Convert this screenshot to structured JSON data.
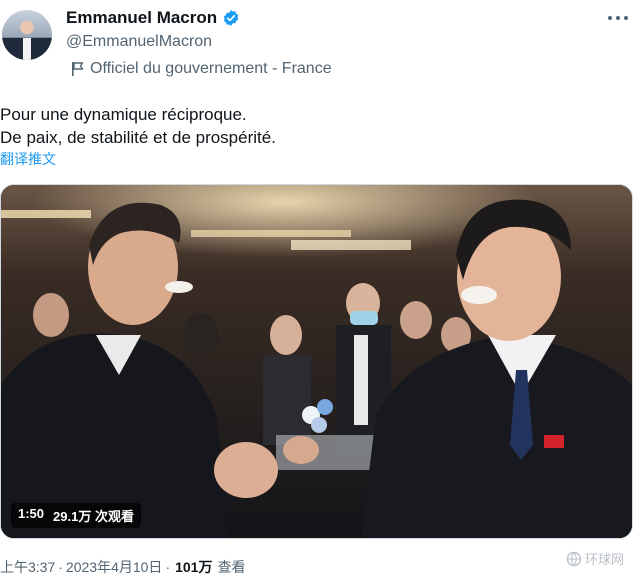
{
  "author": {
    "name": "Emmanuel Macron",
    "handle": "@EmmanuelMacron",
    "affiliation": "Officiel du gouvernement - France",
    "verified_icon": "verified-badge-icon",
    "affiliation_icon": "flag-icon"
  },
  "tweet": {
    "line1": "Pour une dynamique réciproque.",
    "line2": "De paix, de stabilité et de prospérité.",
    "translate_label": "翻译推文"
  },
  "media": {
    "duration": "1:50",
    "views_label": "29.1万 次观看"
  },
  "meta": {
    "time": "上午3:37",
    "date": "2023年4月10日",
    "views_count": "101万",
    "views_suffix": "查看"
  },
  "watermark": "环球网",
  "colors": {
    "text": "#0f1419",
    "secondary": "#536471",
    "link": "#1d9bf0",
    "verified": "#1d9bf0"
  }
}
